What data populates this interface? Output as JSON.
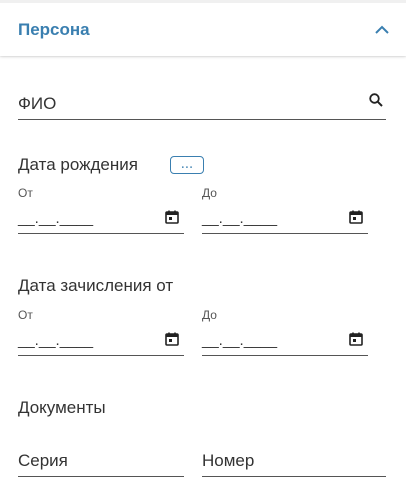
{
  "header": {
    "title": "Персона",
    "collapse_icon": "chevron-up-icon",
    "accent_color": "#3a7fb0"
  },
  "fio": {
    "label": "ФИО",
    "icon": "search-icon"
  },
  "birth_date": {
    "title": "Дата рождения",
    "more_label": "...",
    "from": {
      "label": "От",
      "value": "__.__.____"
    },
    "to": {
      "label": "До",
      "value": "__.__.____"
    }
  },
  "enrollment_date": {
    "title": "Дата зачисления от",
    "from": {
      "label": "От",
      "value": "__.__.____"
    },
    "to": {
      "label": "До",
      "value": "__.__.____"
    }
  },
  "documents": {
    "title": "Документы",
    "series_label": "Серия",
    "number_label": "Номер"
  }
}
